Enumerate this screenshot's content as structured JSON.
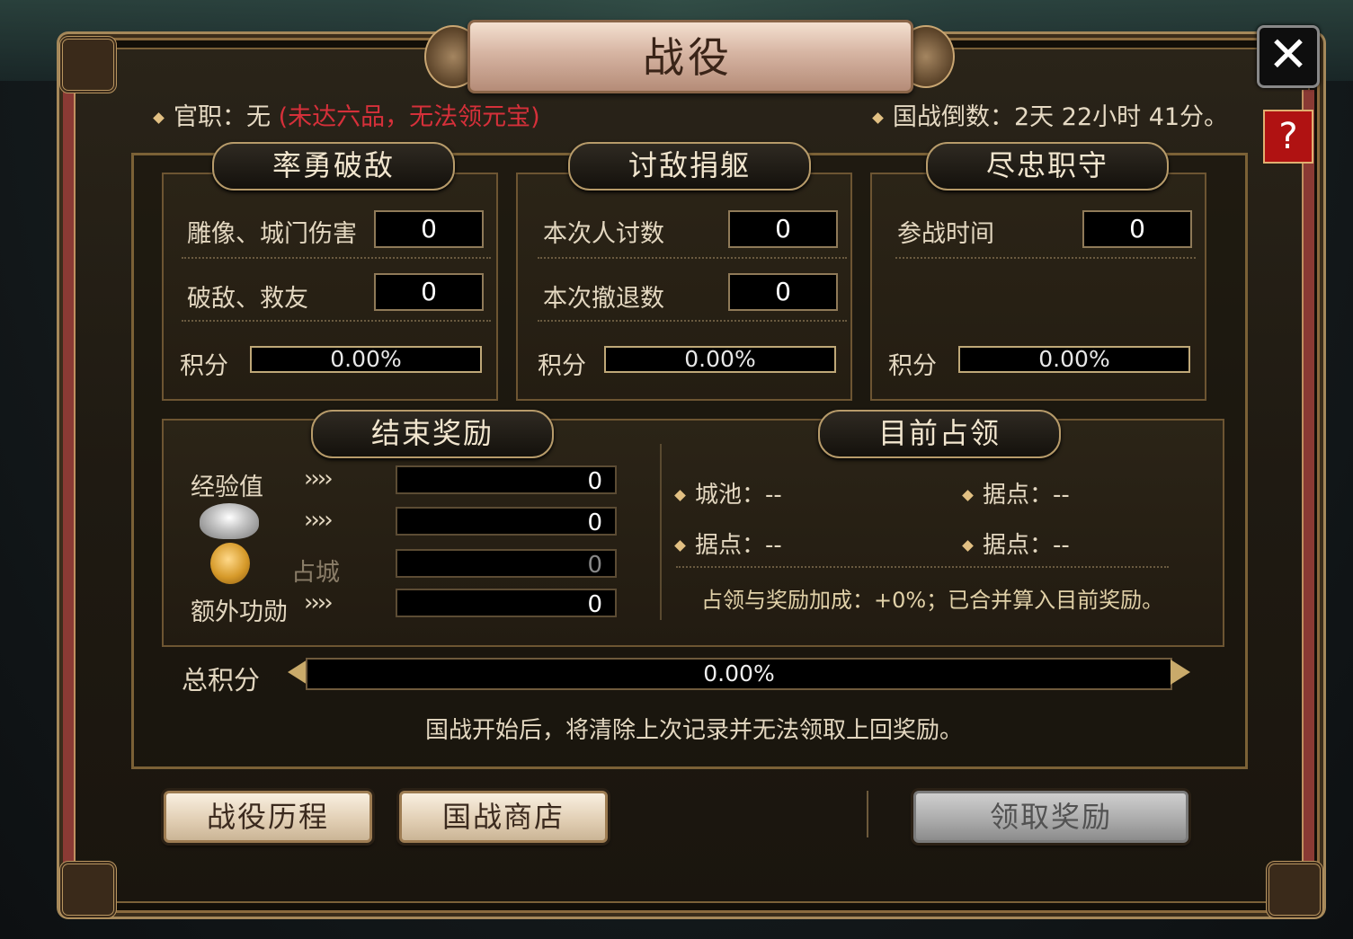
{
  "title": "战役",
  "close_label": "✕",
  "help_label": "?",
  "header": {
    "rank_text": "官职：无",
    "rank_warning": "(未达六品，无法领元宝)",
    "countdown_text": "国战倒数：2天 22小时 41分。"
  },
  "sections": [
    {
      "title": "率勇破敌",
      "rows": [
        {
          "label": "雕像、城门伤害",
          "value": "0"
        },
        {
          "label": "破敌、救友",
          "value": "0"
        }
      ],
      "score_label": "积分",
      "score": "0.00%"
    },
    {
      "title": "讨敌捐躯",
      "rows": [
        {
          "label": "本次人讨数",
          "value": "0"
        },
        {
          "label": "本次撤退数",
          "value": "0"
        }
      ],
      "score_label": "积分",
      "score": "0.00%"
    },
    {
      "title": "尽忠职守",
      "rows": [
        {
          "label": "参战时间",
          "value": "0"
        }
      ],
      "score_label": "积分",
      "score": "0.00%"
    }
  ],
  "rewards": {
    "title": "结束奖励",
    "exp_label": "经验值",
    "exp_value": "0",
    "silver_value": "0",
    "occupy_label": "占城",
    "occupy_value": "0",
    "extra_label": "额外功勋",
    "extra_value": "0",
    "arrows": "››››"
  },
  "occupation": {
    "title": "目前占领",
    "items": [
      "城池：--",
      "据点：--",
      "据点：--",
      "据点：--"
    ],
    "note": "占领与奖励加成：+0%；已合并算入目前奖励。"
  },
  "total": {
    "label": "总积分",
    "value": "0.00%"
  },
  "footnote": "国战开始后，将清除上次记录并无法领取上回奖励。",
  "buttons": {
    "history": "战役历程",
    "shop": "国战商店",
    "claim": "领取奖励"
  },
  "icons": {
    "close": "close-icon",
    "help": "help-icon",
    "silver": "silver-ingot-icon",
    "coin": "gold-coin-icon"
  },
  "colors": {
    "warning": "#d6303a",
    "accent": "#b79b6a"
  }
}
